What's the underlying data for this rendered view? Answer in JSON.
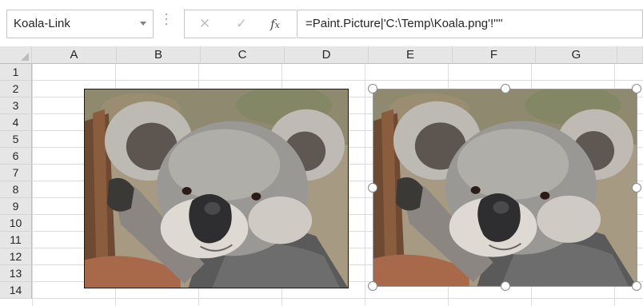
{
  "formula_bar": {
    "name_box": "Koala-Link",
    "cancel_glyph": "✕",
    "enter_glyph": "✓",
    "function_glyph": "fx",
    "formula": "=Paint.Picture|'C:\\Temp\\Koala.png'!''''"
  },
  "columns": [
    "A",
    "B",
    "C",
    "D",
    "E",
    "F",
    "G"
  ],
  "rows": [
    "1",
    "2",
    "3",
    "4",
    "5",
    "6",
    "7",
    "8",
    "9",
    "10",
    "11",
    "12",
    "13",
    "14"
  ],
  "pictures": [
    {
      "subject": "koala photograph",
      "selected": false
    },
    {
      "subject": "koala photograph",
      "selected": true
    }
  ],
  "colors": {
    "header_bg": "#e6e6e6",
    "gridline": "#dcdcdc",
    "selection_handle": "#ffffff"
  }
}
